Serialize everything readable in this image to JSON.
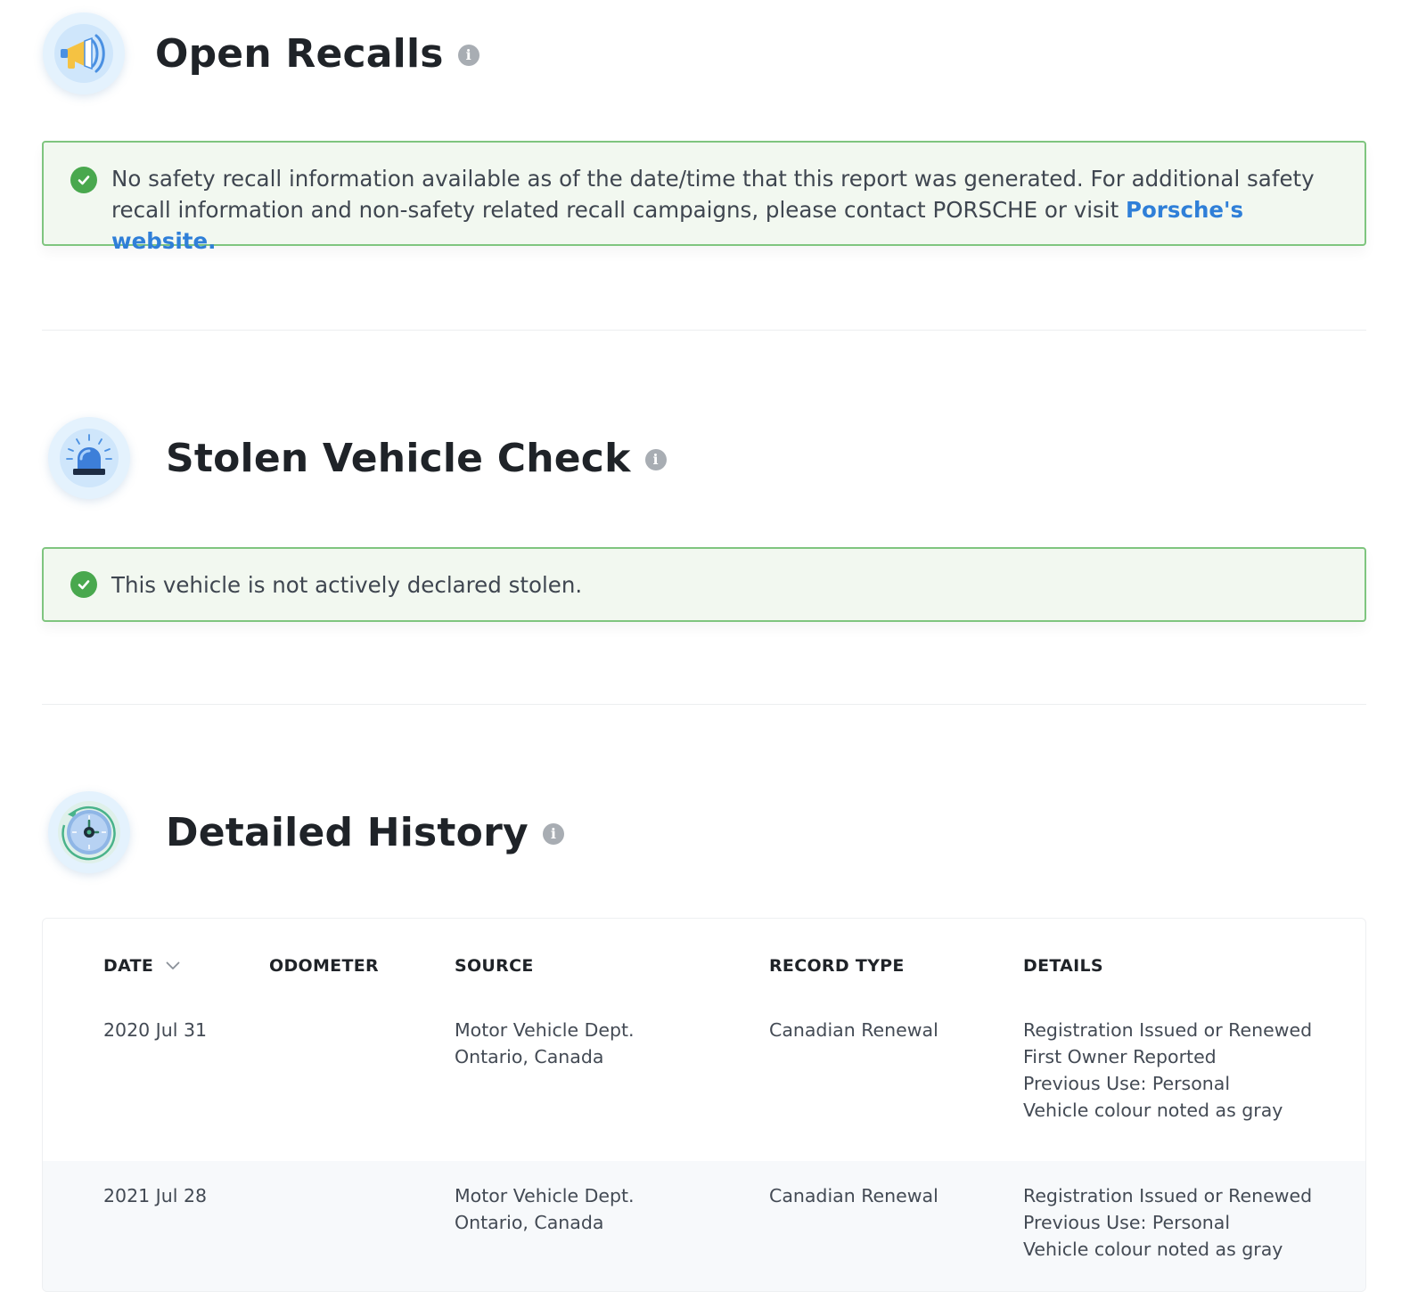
{
  "recalls": {
    "title": "Open Recalls",
    "icon": "megaphone-icon",
    "message": "No safety recall information available as of the date/time that this report was generated. For additional safety recall information and non-safety related recall campaigns, please contact PORSCHE or visit",
    "link_text": "Porsche's website."
  },
  "stolen": {
    "title": "Stolen Vehicle Check",
    "icon": "siren-icon",
    "message": "This vehicle is not actively declared stolen."
  },
  "history": {
    "title": "Detailed History",
    "icon": "clock-icon",
    "columns": {
      "date": "DATE",
      "odometer": "ODOMETER",
      "source": "SOURCE",
      "record_type": "RECORD TYPE",
      "details": "DETAILS"
    },
    "rows": [
      {
        "date": "2020 Jul 31",
        "odometer": "",
        "source": [
          "Motor Vehicle Dept.",
          "Ontario, Canada"
        ],
        "record_type": "Canadian Renewal",
        "details": [
          "Registration Issued or Renewed",
          "First Owner Reported",
          "Previous Use: Personal",
          "Vehicle colour noted as gray"
        ]
      },
      {
        "date": "2021 Jul 28",
        "odometer": "",
        "source": [
          "Motor Vehicle Dept.",
          "Ontario, Canada"
        ],
        "record_type": "Canadian Renewal",
        "details": [
          "Registration Issued or Renewed",
          "Previous Use: Personal",
          "Vehicle colour noted as gray"
        ]
      }
    ]
  },
  "colors": {
    "alert_bg": "#f2f8f0",
    "alert_border": "#7fc57f",
    "check_green": "#49a84e",
    "link_blue": "#2f7fd8",
    "alt_row_bg": "#f7f9fb"
  }
}
